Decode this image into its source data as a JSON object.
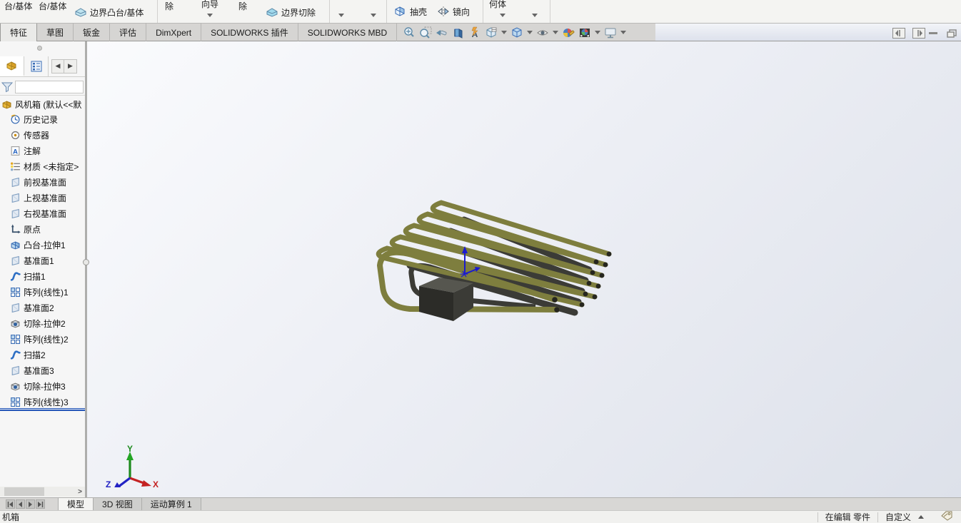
{
  "colors": {
    "tube_olive": "#7e7e3e",
    "tube_dark": "#3b3b36",
    "rollback_bar": "#2557b8",
    "accent": "#2464b0",
    "viewport_gradient_top": "#fafbfd",
    "viewport_gradient_bottom": "#dde1ea"
  },
  "ribbon": {
    "labels": {
      "boss_base_1": "台/基体",
      "boss_base_2": "台/基体",
      "boundary_boss": "边界凸台/基体",
      "cut_1": "除",
      "hole_wizard": "向导",
      "cut_2": "除",
      "boundary_cut": "边界切除",
      "shell": "抽壳",
      "mirror": "镜向",
      "reference_geometry": "何体"
    }
  },
  "command_tabs": {
    "active": "特征",
    "items": [
      "特征",
      "草图",
      "钣金",
      "评估",
      "DimXpert",
      "SOLIDWORKS 插件",
      "SOLIDWORKS MBD"
    ]
  },
  "headsup_toolbar": {
    "icons": [
      "zoom-fit",
      "zoom-area",
      "previous-view",
      "section-view",
      "annotation-views",
      "view-orientation",
      "display-style",
      "hide-show-items",
      "edit-appearance",
      "apply-scene",
      "view-settings"
    ],
    "with_caret": [
      "view-orientation",
      "display-style",
      "hide-show-items",
      "apply-scene",
      "view-settings"
    ]
  },
  "feature_tree": {
    "root": "风机箱  (默认<<默",
    "items": [
      {
        "label": "历史记录",
        "icon": "history-icon"
      },
      {
        "label": "传感器",
        "icon": "sensors-icon"
      },
      {
        "label": "注解",
        "icon": "annotations-icon"
      },
      {
        "label": "材质 <未指定>",
        "icon": "material-icon"
      },
      {
        "label": "前视基准面",
        "icon": "plane-icon"
      },
      {
        "label": "上视基准面",
        "icon": "plane-icon"
      },
      {
        "label": "右视基准面",
        "icon": "plane-icon"
      },
      {
        "label": "原点",
        "icon": "origin-icon"
      },
      {
        "label": "凸台-拉伸1",
        "icon": "boss-extrude-icon"
      },
      {
        "label": "基准面1",
        "icon": "plane-icon"
      },
      {
        "label": "扫描1",
        "icon": "sweep-icon"
      },
      {
        "label": "阵列(线性)1",
        "icon": "linear-pattern-icon"
      },
      {
        "label": "基准面2",
        "icon": "plane-icon"
      },
      {
        "label": "切除-拉伸2",
        "icon": "cut-extrude-icon"
      },
      {
        "label": "阵列(线性)2",
        "icon": "linear-pattern-icon"
      },
      {
        "label": "扫描2",
        "icon": "sweep-icon"
      },
      {
        "label": "基准面3",
        "icon": "plane-icon"
      },
      {
        "label": "切除-拉伸3",
        "icon": "cut-extrude-icon"
      },
      {
        "label": "阵列(线性)3",
        "icon": "linear-pattern-icon"
      }
    ]
  },
  "doc_tabs": {
    "active": "模型",
    "items": [
      "模型",
      "3D 视图",
      "运动算例 1"
    ]
  },
  "status_bar": {
    "left": "机箱",
    "editing": "在编辑 零件",
    "custom": "自定义"
  },
  "triad": {
    "x": "X",
    "y": "Y",
    "z": "Z"
  }
}
